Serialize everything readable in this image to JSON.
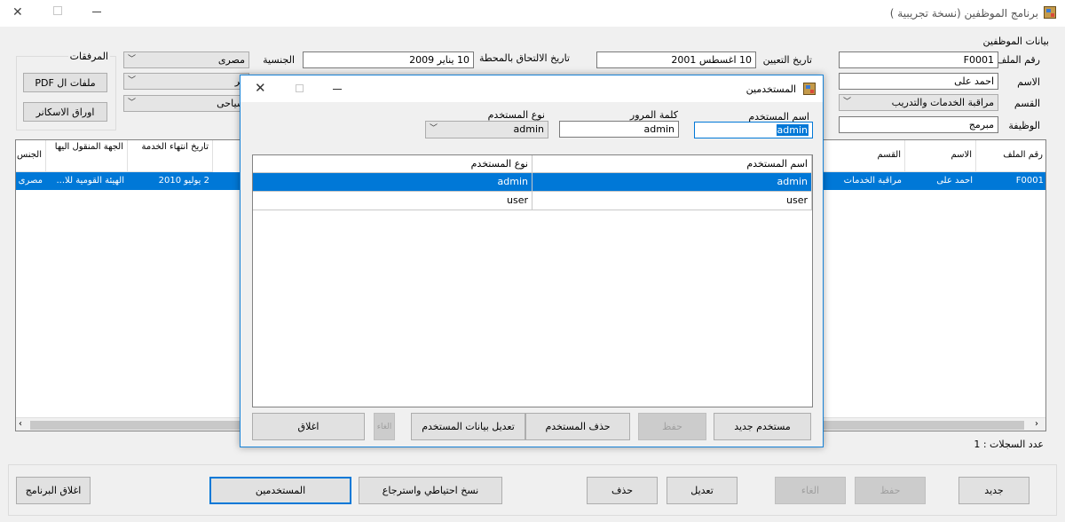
{
  "window": {
    "title": "برنامج الموظفين (نسخة تجريبية )"
  },
  "employee_section": {
    "title": "بيانات الموظفين",
    "file_no_label": "رقم الملف",
    "file_no": "F0001",
    "name_label": "الاسم",
    "name": "احمد على",
    "dept_label": "القسم",
    "dept": "مراقبة الخدمات والتدريب",
    "job_label": "الوظيفة",
    "job": "مبرمج",
    "appoint_label": "تاريخ التعيين",
    "appoint_date": "10 اغسطس 2001",
    "join_label": "تاريخ الالتحاق بالمحطة",
    "join_date": "10 يناير 2009",
    "nationality_label": "الجنسية",
    "nationality": "مصرى",
    "combo2_partial": "كر",
    "combo3_partial": "سياحى"
  },
  "attachments": {
    "title": "المرفقات",
    "pdf_button": "ملفات ال PDF",
    "scanner_button": "اوراق الاسكانر"
  },
  "main_grid": {
    "headers": {
      "file_no": "رقم الملف",
      "name": "الاسم",
      "dept": "القسم",
      "end_service": "تاريخ انتهاء الخدمة",
      "transfer_to": "الجهة المنقول اليها",
      "nationality": "الجنس"
    },
    "row": {
      "file_no": "F0001",
      "name": "احمد على",
      "dept": "مراقبة الخدمات",
      "end_service": "2 يوليو 2010",
      "transfer_to": "الهيئة القومية للا...",
      "nationality": "مصرى"
    }
  },
  "record_count": "عدد السجلات : 1",
  "bottom_buttons": {
    "new": "جديد",
    "save": "حفظ",
    "cancel": "الغاء",
    "edit": "تعديل",
    "delete": "حذف",
    "backup": "نسخ احتياطي واسترجاع",
    "users": "المستخدمين",
    "close_program": "اغلاق البرنامج"
  },
  "dialog": {
    "title": "المستخدمين",
    "username_label": "اسم المستخدم",
    "username": "admin",
    "password_label": "كلمة المرور",
    "password": "admin",
    "usertype_label": "نوع المستخدم",
    "usertype": "admin",
    "grid_headers": {
      "username": "اسم المستخدم",
      "usertype": "نوع المستخدم"
    },
    "rows": [
      {
        "username": "admin",
        "usertype": "admin"
      },
      {
        "username": "user",
        "usertype": "user"
      }
    ],
    "buttons": {
      "new_user": "مستخدم جديد",
      "save": "حفظ",
      "delete_user": "حذف المستخدم",
      "edit_user": "تعديل بيانات المستخدم",
      "cancel": "الغاء",
      "close": "اغلاق"
    }
  }
}
